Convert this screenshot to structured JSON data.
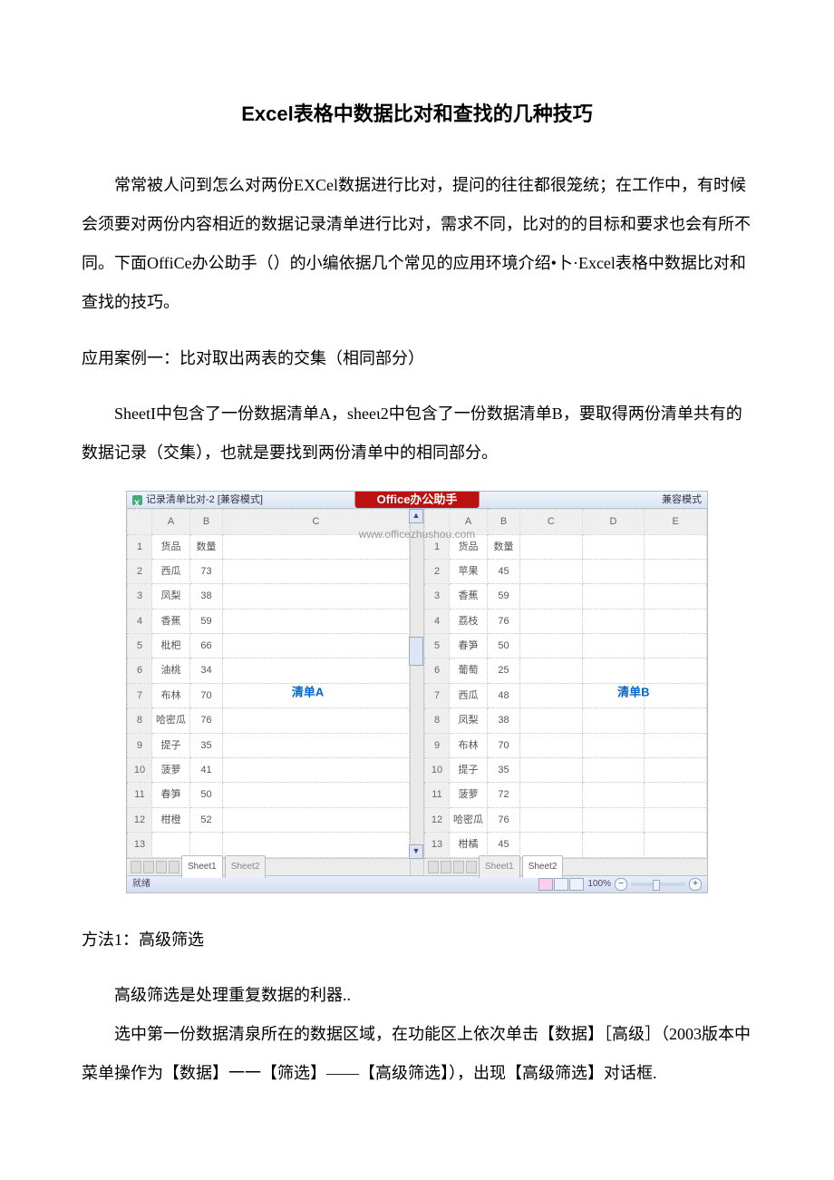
{
  "title_prefix": "Excel",
  "title_rest": "表格中数据比对和查找的几种技巧",
  "para1": "常常被人问到怎么对两份EXCel数据进行比对，提问的往往都很笼统；在工作中，有时候会须要对两份内容相近的数据记录清单进行比对，需求不同，比对的的目标和要求也会有所不同。下面OffiCe办公助手（）的小编依据几个常见的应用环境介绍•卜·Excel表格中数据比对和查找的技巧。",
  "heading_case1": "应用案例一：比对取出两表的交集（相同部分）",
  "para2": "SheetI中包含了一份数据清单A，sheeι2中包含了一份数据清单B，要取得两份清单共有的数据记录（交集），也就是要找到两份清单中的相同部分。",
  "method1_heading": "方法1：高级筛选",
  "para3": "高级筛选是处理重复数据的利器..",
  "para4": "选中第一份数据清泉所在的数据区域，在功能区上依次单击【数据】［高级］（2003版本中菜单操作为【数据】一一【筛选】——【高级筛选】），出现【高级筛选】对话框.",
  "figure": {
    "window_caption": "记录清单比对-2 [兼容模式]",
    "right_caption": "兼容模式",
    "banner": "Office办公助手",
    "url": "www.officezhushou.com",
    "colA_label": "A",
    "colB_label": "B",
    "colC_label": "C",
    "colD_label": "D",
    "colE_label": "E",
    "header_item": "货品",
    "header_qty": "数量",
    "listA_label": "清单A",
    "listB_label": "清单B",
    "sheet1_tab": "Sheet1",
    "sheet2_tab": "Sheet2",
    "status_ready": "就绪",
    "zoom_label": "100%",
    "sheetA_rows": [
      {
        "n": "1",
        "a": "货品",
        "b": "数量"
      },
      {
        "n": "2",
        "a": "西瓜",
        "b": "73"
      },
      {
        "n": "3",
        "a": "凤梨",
        "b": "38"
      },
      {
        "n": "4",
        "a": "香蕉",
        "b": "59"
      },
      {
        "n": "5",
        "a": "枇杷",
        "b": "66"
      },
      {
        "n": "6",
        "a": "油桃",
        "b": "34"
      },
      {
        "n": "7",
        "a": "布林",
        "b": "70"
      },
      {
        "n": "8",
        "a": "哈密瓜",
        "b": "76"
      },
      {
        "n": "9",
        "a": "提子",
        "b": "35"
      },
      {
        "n": "10",
        "a": "菠萝",
        "b": "41"
      },
      {
        "n": "11",
        "a": "春笋",
        "b": "50"
      },
      {
        "n": "12",
        "a": "柑橙",
        "b": "52"
      },
      {
        "n": "13",
        "a": "",
        "b": ""
      }
    ],
    "sheetB_rows": [
      {
        "n": "1",
        "a": "货品",
        "b": "数量"
      },
      {
        "n": "2",
        "a": "苹果",
        "b": "45"
      },
      {
        "n": "3",
        "a": "香蕉",
        "b": "59"
      },
      {
        "n": "4",
        "a": "荔枝",
        "b": "76"
      },
      {
        "n": "5",
        "a": "春笋",
        "b": "50"
      },
      {
        "n": "6",
        "a": "葡萄",
        "b": "25"
      },
      {
        "n": "7",
        "a": "西瓜",
        "b": "48"
      },
      {
        "n": "8",
        "a": "凤梨",
        "b": "38"
      },
      {
        "n": "9",
        "a": "布林",
        "b": "70"
      },
      {
        "n": "10",
        "a": "提子",
        "b": "35"
      },
      {
        "n": "11",
        "a": "菠萝",
        "b": "72"
      },
      {
        "n": "12",
        "a": "哈密瓜",
        "b": "76"
      },
      {
        "n": "13",
        "a": "柑橘",
        "b": "45"
      }
    ]
  }
}
